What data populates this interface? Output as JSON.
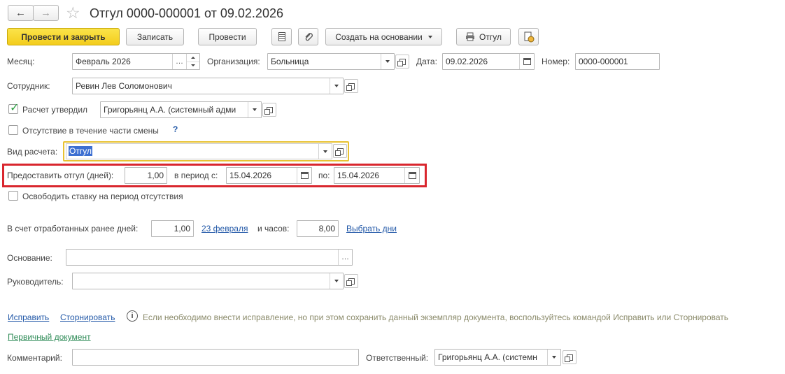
{
  "header": {
    "title": "Отгул 0000-000001 от 09.02.2026",
    "back_glyph": "←",
    "forward_glyph": "→",
    "star_glyph": "☆"
  },
  "toolbar": {
    "post_close": "Провести и закрыть",
    "save": "Записать",
    "post": "Провести",
    "create_based": "Создать на основании",
    "print_label": "Отгул"
  },
  "fields": {
    "month_label": "Месяц:",
    "month_value": "Февраль 2026",
    "org_label": "Организация:",
    "org_value": "Больница",
    "date_label": "Дата:",
    "date_value": "09.02.2026",
    "number_label": "Номер:",
    "number_value": "0000-000001",
    "employee_label": "Сотрудник:",
    "employee_value": "Ревин Лев Соломонович",
    "approved_label": "Расчет утвердил",
    "approved_value": "Григорьянц А.А. (системный адми",
    "partial_shift_label": "Отсутствие в течение части смены",
    "help_glyph": "?",
    "calc_type_label": "Вид расчета:",
    "calc_type_value": "Отгул",
    "grant_label": "Предоставить отгул (дней):",
    "grant_value": "1,00",
    "period_from_label": "в период с:",
    "period_from_value": "15.04.2026",
    "period_to_label": "по:",
    "period_to_value": "15.04.2026",
    "free_rate_label": "Освободить ставку на период отсутствия",
    "worked_days_label": "В счет отработанных ранее дней:",
    "worked_days_value": "1,00",
    "worked_date_link": "23 февраля",
    "hours_label": "и часов:",
    "hours_value": "8,00",
    "choose_days_link": "Выбрать дни",
    "basis_label": "Основание:",
    "basis_value": "",
    "manager_label": "Руководитель:",
    "manager_value": "",
    "comment_label": "Комментарий:",
    "comment_value": "",
    "responsible_label": "Ответственный:",
    "responsible_value": "Григорьянц А.А. (системн"
  },
  "links": {
    "fix": "Исправить",
    "reverse": "Сторнировать",
    "info_text": "Если необходимо внести исправление, но при этом сохранить данный экземпляр документа, воспользуйтесь командой Исправить или Сторнировать",
    "primary_doc": "Первичный документ"
  },
  "colors": {
    "highlight_box": "#d9262e",
    "focus_border": "#e8c232",
    "selection": "#3d6fd1",
    "link": "#2359a8",
    "link_green": "#2e8b57"
  }
}
